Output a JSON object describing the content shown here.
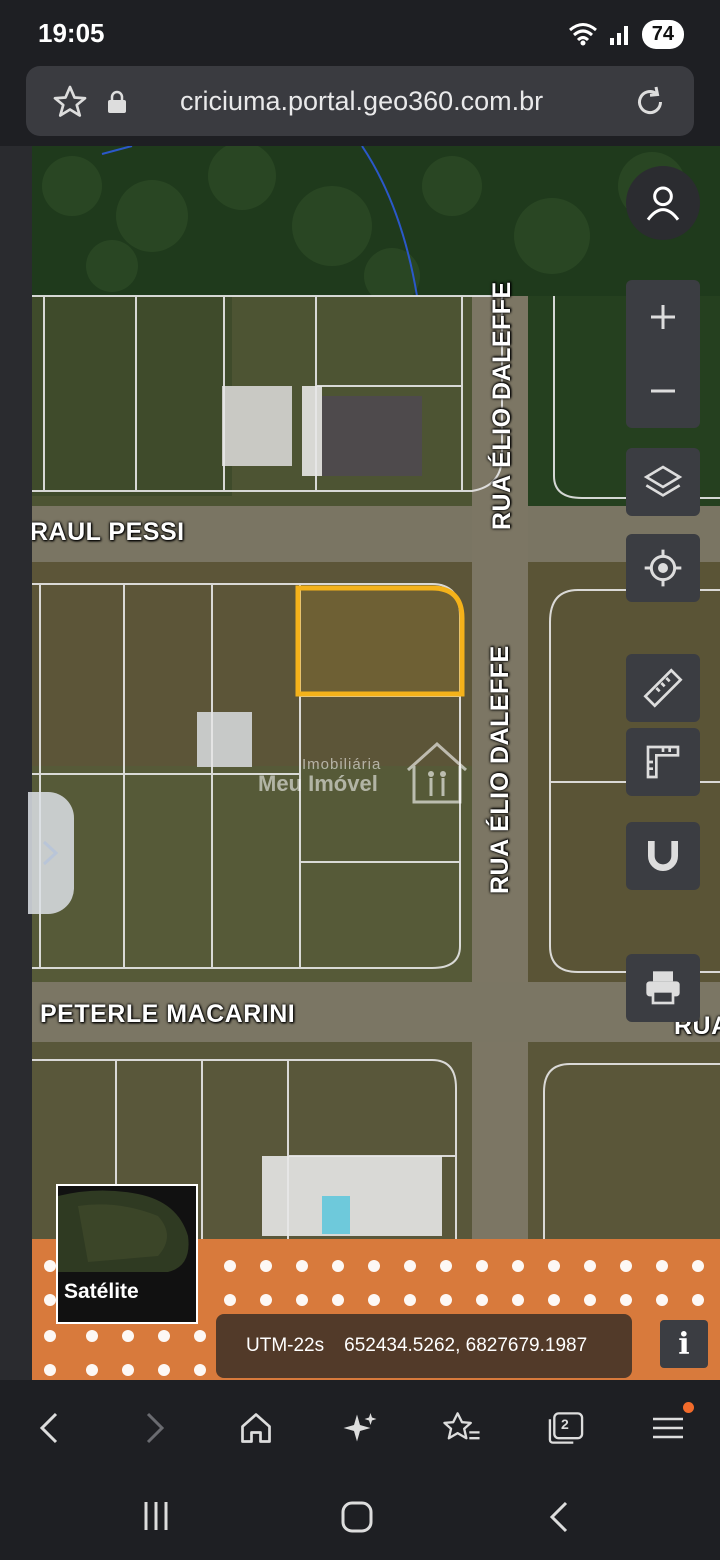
{
  "status": {
    "time": "19:05",
    "battery": "74"
  },
  "browser": {
    "url": "criciuma.portal.geo360.com.br"
  },
  "map": {
    "streets": {
      "raul_pessi": "RAUL PESSI",
      "elio_daleffe_top": "RUA ÉLIO DALEFFE",
      "elio_daleffe_mid": "RUA ÉLIO DALEFFE",
      "peterle_macarini": "PETERLE MACARINI",
      "rua_partial": "RUA"
    },
    "watermark": {
      "small": "Imobiliária",
      "big": "Meu Imóvel"
    },
    "highlight_color": "#f4b21a",
    "basemap_label": "Satélite",
    "coordinates": {
      "system": "UTM-22s",
      "value": "652434.5262, 6827679.1987"
    },
    "info_label": "i"
  },
  "icons": [
    "star-icon",
    "lock-icon",
    "reload-icon",
    "user-icon",
    "zoom-in-icon",
    "zoom-out-icon",
    "layers-icon",
    "locate-icon",
    "ruler-icon",
    "area-measure-icon",
    "magnet-icon",
    "print-icon",
    "back-icon",
    "forward-icon",
    "home-icon",
    "ai-sparkle-icon",
    "bookmarks-icon",
    "tabs-icon",
    "menu-icon"
  ],
  "nav": {
    "tab_count": "2"
  }
}
